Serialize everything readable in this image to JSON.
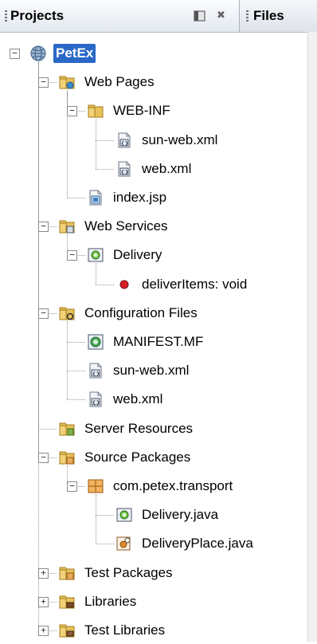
{
  "tabs": {
    "projects": "Projects",
    "files": "Files"
  },
  "tree": [
    {
      "label": "PetEx",
      "level": 0,
      "toggle": "minus",
      "icon": "project-globe-icon",
      "selected": true
    },
    {
      "label": "Web Pages",
      "level": 1,
      "toggle": "minus",
      "icon": "web-pages-folder-icon"
    },
    {
      "label": "WEB-INF",
      "level": 2,
      "toggle": "minus",
      "icon": "folder-icon"
    },
    {
      "label": "sun-web.xml",
      "level": 3,
      "icon": "xml-file-icon"
    },
    {
      "label": "web.xml",
      "level": 3,
      "icon": "xml-file-icon"
    },
    {
      "label": "index.jsp",
      "level": 2,
      "icon": "jsp-file-icon"
    },
    {
      "label": "Web Services",
      "level": 1,
      "toggle": "minus",
      "icon": "web-services-folder-icon"
    },
    {
      "label": "Delivery",
      "level": 2,
      "toggle": "minus",
      "icon": "web-service-icon"
    },
    {
      "label": "deliverItems: void",
      "level": 3,
      "icon": "operation-red-dot-icon"
    },
    {
      "label": "Configuration Files",
      "level": 1,
      "toggle": "minus",
      "icon": "config-folder-icon"
    },
    {
      "label": "MANIFEST.MF",
      "level": 2,
      "icon": "manifest-file-icon"
    },
    {
      "label": "sun-web.xml",
      "level": 2,
      "icon": "xml-file-icon"
    },
    {
      "label": "web.xml",
      "level": 2,
      "icon": "xml-file-icon"
    },
    {
      "label": "Server Resources",
      "level": 1,
      "icon": "server-resources-folder-icon"
    },
    {
      "label": "Source Packages",
      "level": 1,
      "toggle": "minus",
      "icon": "source-packages-folder-icon"
    },
    {
      "label": "com.petex.transport",
      "level": 2,
      "toggle": "minus",
      "icon": "package-icon"
    },
    {
      "label": "Delivery.java",
      "level": 3,
      "icon": "java-webservice-file-icon"
    },
    {
      "label": "DeliveryPlace.java",
      "level": 3,
      "icon": "java-class-file-icon"
    },
    {
      "label": "Test Packages",
      "level": 1,
      "toggle": "plus",
      "icon": "test-packages-folder-icon"
    },
    {
      "label": "Libraries",
      "level": 1,
      "toggle": "plus",
      "icon": "libraries-folder-icon"
    },
    {
      "label": "Test Libraries",
      "level": 1,
      "toggle": "plus",
      "icon": "test-libraries-folder-icon"
    }
  ]
}
